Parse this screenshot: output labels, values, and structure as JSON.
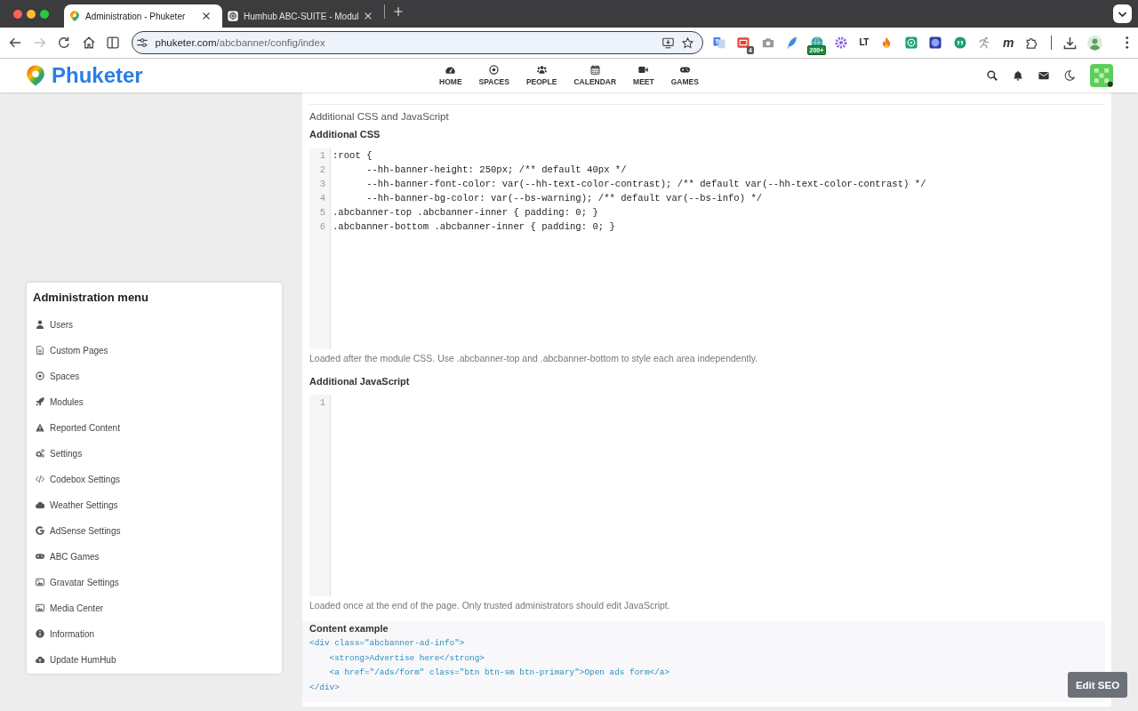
{
  "browser": {
    "tabs": [
      {
        "title": "Administration - Phuketer",
        "kind": "pin",
        "selected": true
      },
      {
        "title": "Humhub ABC-SUITE - Modul",
        "kind": "knot",
        "selected": false
      }
    ],
    "nav_buttons": [
      {
        "kind": "back",
        "disabled": false
      },
      {
        "kind": "forward",
        "disabled": true
      },
      {
        "kind": "reload",
        "disabled": false
      },
      {
        "kind": "home",
        "disabled": false
      },
      {
        "kind": "split",
        "disabled": false
      }
    ],
    "address": {
      "host": "phuketer.com",
      "path": "/abcbanner/config/index"
    },
    "extensions": [
      {
        "kind": "translate"
      },
      {
        "kind": "mail",
        "badge": "4"
      },
      {
        "kind": "camera"
      },
      {
        "kind": "feather"
      },
      {
        "kind": "globe",
        "badge": "200+"
      },
      {
        "kind": "flower"
      },
      {
        "kind": "lettermark",
        "text": "LT"
      },
      {
        "kind": "flame"
      },
      {
        "kind": "player"
      },
      {
        "kind": "planet"
      },
      {
        "kind": "quote"
      },
      {
        "kind": "runner"
      },
      {
        "kind": "monogram",
        "text": "m"
      },
      {
        "kind": "puzzle"
      }
    ]
  },
  "header": {
    "brand": "Phuketer",
    "nav": [
      {
        "label": "HOME",
        "kind": "gauge"
      },
      {
        "label": "SPACES",
        "kind": "target"
      },
      {
        "label": "PEOPLE",
        "kind": "users"
      },
      {
        "label": "CALENDAR",
        "kind": "calendar"
      },
      {
        "label": "MEET",
        "kind": "video"
      },
      {
        "label": "GAMES",
        "kind": "gamepad"
      }
    ]
  },
  "admin_menu": {
    "title": "Administration menu",
    "items": [
      {
        "label": "Users",
        "kind": "user"
      },
      {
        "label": "Custom Pages",
        "kind": "file"
      },
      {
        "label": "Spaces",
        "kind": "target"
      },
      {
        "label": "Modules",
        "kind": "rocket"
      },
      {
        "label": "Reported Content",
        "kind": "warning"
      },
      {
        "label": "Settings",
        "kind": "cogs"
      },
      {
        "label": "Codebox Settings",
        "kind": "code"
      },
      {
        "label": "Weather Settings",
        "kind": "cloud"
      },
      {
        "label": "AdSense Settings",
        "kind": "google"
      },
      {
        "label": "ABC Games",
        "kind": "gamepad"
      },
      {
        "label": "Gravatar Settings",
        "kind": "image"
      },
      {
        "label": "Media Center",
        "kind": "image"
      },
      {
        "label": "Information",
        "kind": "info"
      },
      {
        "label": "Update HumHub",
        "kind": "upload"
      }
    ]
  },
  "settings": {
    "section_title": "Additional CSS and JavaScript",
    "css": {
      "label": "Additional CSS",
      "lines": [
        {
          "number": "1",
          "code": ":root {"
        },
        {
          "number": "2",
          "code": "      --hh-banner-height: 250px; /** default 40px */"
        },
        {
          "number": "3",
          "code": "      --hh-banner-font-color: var(--hh-text-color-contrast); /** default var(--hh-text-color-contrast) */"
        },
        {
          "number": "4",
          "code": "      --hh-banner-bg-color: var(--bs-warning); /** default var(--bs-info) */"
        },
        {
          "number": "5",
          "code": ".abcbanner-top .abcbanner-inner { padding: 0; }"
        },
        {
          "number": "6",
          "code": ".abcbanner-bottom .abcbanner-inner { padding: 0; }"
        }
      ],
      "help": "Loaded after the module CSS. Use .abcbanner-top and .abcbanner-bottom to style each area independently."
    },
    "js": {
      "label": "Additional JavaScript",
      "lines": [
        {
          "number": "1"
        }
      ],
      "help": "Loaded once at the end of the page. Only trusted administrators should edit JavaScript."
    },
    "content_example": {
      "title": "Content example",
      "lines": [
        "<div class=\"abcbanner-ad-info\">",
        "    <strong>Advertise here</strong>",
        "    <a href=\"/ads/form\" class=\"btn btn-sm btn-primary\">Open ads form</a>",
        "</div>"
      ]
    }
  },
  "edit_seo_button": {
    "label": "Edit SEO"
  }
}
